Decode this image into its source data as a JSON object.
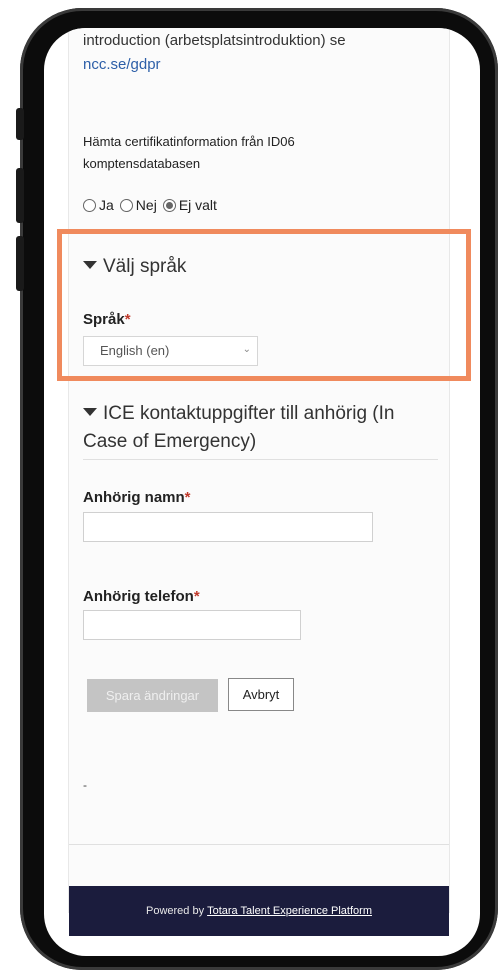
{
  "intro_text": "introduction (arbetsplatsintroduktion) se",
  "gdpr_link": "ncc.se/gdpr",
  "cert_question": "Hämta certifikatinformation från ID06 komptensdatabasen",
  "radio_options": [
    "Ja",
    "Nej",
    "Ej valt"
  ],
  "radio_selected": "Ej valt",
  "language_section": {
    "title": "Välj språk",
    "label": "Språk",
    "selected": "English (en)"
  },
  "ice_section": {
    "title": "ICE kontaktuppgifter till anhörig (In Case of Emergency)",
    "name_label": "Anhörig namn",
    "phone_label": "Anhörig telefon"
  },
  "required_marker": "*",
  "buttons": {
    "save": "Spara ändringar",
    "cancel": "Avbryt"
  },
  "dash_text": "-",
  "footer": {
    "prefix": "Powered by",
    "link": "Totara Talent Experience Platform"
  },
  "colors": {
    "highlight": "#f08a5d",
    "link": "#2d5fa8",
    "footer_bg": "#1b1c3d",
    "required": "#c0392b"
  }
}
